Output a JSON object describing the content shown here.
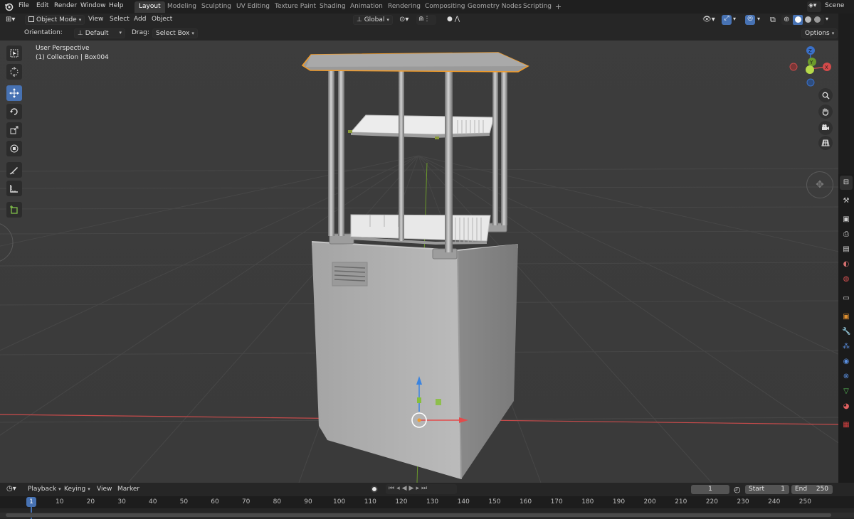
{
  "menubar": {
    "items": [
      "File",
      "Edit",
      "Render",
      "Window",
      "Help"
    ],
    "workspaces": [
      "Layout",
      "Modeling",
      "Sculpting",
      "UV Editing",
      "Texture Paint",
      "Shading",
      "Animation",
      "Rendering",
      "Compositing",
      "Geometry Nodes",
      "Scripting"
    ],
    "active_workspace": "Layout",
    "add_tab": "+",
    "scene_label": "Scene"
  },
  "viewport_header": {
    "mode": "Object Mode",
    "menus": [
      "View",
      "Select",
      "Add",
      "Object"
    ],
    "transform_orientation": "Global",
    "options_label": "Options"
  },
  "tool_settings": {
    "orientation_label": "Orientation:",
    "orientation_value": "Default",
    "drag_label": "Drag:",
    "drag_value": "Select Box"
  },
  "viewport": {
    "perspective_label": "User Perspective",
    "collection_label": "(1) Collection | Box004",
    "gizmo_axes": {
      "x": "X",
      "y": "Y",
      "z": "Z"
    },
    "colors": {
      "background": "#3d3d3d",
      "grid": "#4a4a4a",
      "x_axis": "#c94b4b",
      "y_axis": "#6b9a2b",
      "selection": "#f29c2a"
    }
  },
  "toolbar": {
    "tools": [
      "select-box-icon",
      "cursor-icon",
      "move-icon",
      "rotate-icon",
      "scale-icon",
      "transform-icon",
      "annotate-icon",
      "measure-icon",
      "add-cube-icon"
    ],
    "active_tool": "move-icon"
  },
  "navigation_gizmo": {
    "buttons": [
      "zoom-icon",
      "hand-icon",
      "camera-icon",
      "grid-view-icon"
    ]
  },
  "properties_tabs": [
    "tool-icon",
    "render-icon",
    "output-icon",
    "view-layer-icon",
    "scene-icon",
    "world-icon",
    "collection-icon",
    "object-icon",
    "modifier-icon",
    "particles-icon",
    "physics-icon",
    "constraints-icon",
    "data-icon",
    "material-icon",
    "texture-icon"
  ],
  "timeline": {
    "menus": [
      "Playback",
      "Keying",
      "View",
      "Marker"
    ],
    "current_frame": "1",
    "start_label": "Start",
    "start_value": "1",
    "end_label": "End",
    "end_value": "250",
    "ruler_ticks": [
      "1",
      "10",
      "20",
      "30",
      "40",
      "50",
      "60",
      "70",
      "80",
      "90",
      "100",
      "110",
      "120",
      "130",
      "140",
      "150",
      "160",
      "170",
      "180",
      "190",
      "200",
      "210",
      "220",
      "230",
      "240",
      "250"
    ]
  }
}
